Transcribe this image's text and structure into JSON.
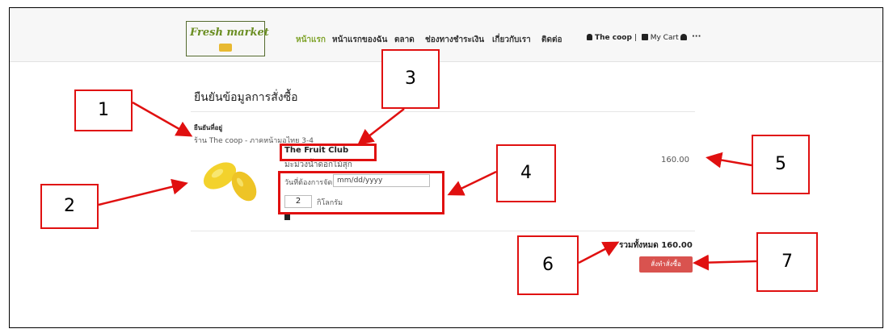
{
  "logo": {
    "text": "Fresh market"
  },
  "nav": {
    "items": [
      {
        "label": "หน้าแรก",
        "active": true
      },
      {
        "label": "หน้าแรกของฉัน",
        "active": false
      },
      {
        "label": "ตลาด",
        "active": false
      },
      {
        "label": "ช่องทางชำระเงิน",
        "active": false
      },
      {
        "label": "เกี่ยวกับเรา",
        "active": false
      },
      {
        "label": "ติดต่อ",
        "active": false
      }
    ],
    "user": "The coop",
    "separator": "|",
    "cart": "My Cart",
    "more": "···",
    "active_color": "#7fa32a"
  },
  "page": {
    "title": "ยืนยันข้อมูลการสั่งซื้อ"
  },
  "address": {
    "label": "ยืนยันที่อยู่",
    "value": "ร้าน The coop - ภาคหน้ามอไทย 3-4"
  },
  "item": {
    "shop": "The Fruit Club",
    "product": "มะม่วงน้ำดอกไม้สุก",
    "delivery_label": "วันที่ต้องการจัดส่ง",
    "date_placeholder": "mm/dd/yyyy",
    "quantity": "2",
    "unit": "กิโลกรัม",
    "price": "160.00"
  },
  "summary": {
    "total_label": "รวมทั้งหมด 160.00",
    "order_button": "สั่งทำสั่งซื้อ",
    "button_color": "#d9534f"
  },
  "callouts": [
    "1",
    "2",
    "3",
    "4",
    "5",
    "6",
    "7"
  ],
  "annotation_color": "#e01010"
}
